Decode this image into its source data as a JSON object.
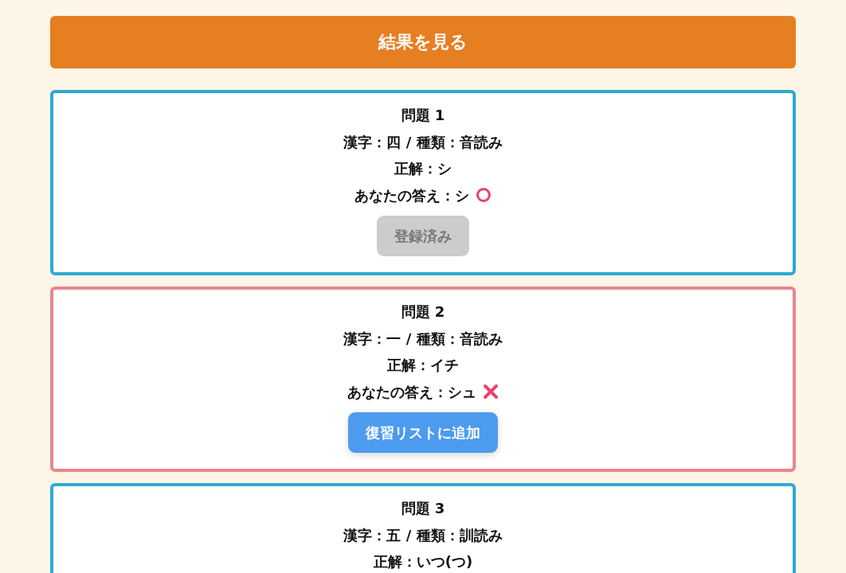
{
  "results_button": {
    "label": "結果を見る"
  },
  "questions": [
    {
      "title": "問題 1",
      "kanji_line": "漢字：四 / 種類：音読み",
      "correct_line": "正解：シ",
      "your_answer_line": "あなたの答え：シ",
      "correct": true,
      "button": {
        "label": "登録済み",
        "disabled": true
      }
    },
    {
      "title": "問題 2",
      "kanji_line": "漢字：一 / 種類：音読み",
      "correct_line": "正解：イチ",
      "your_answer_line": "あなたの答え：シュ",
      "correct": false,
      "button": {
        "label": "復習リストに追加",
        "disabled": false
      }
    },
    {
      "title": "問題 3",
      "kanji_line": "漢字：五 / 種類：訓読み",
      "correct_line": "正解：いつ(つ)",
      "correct": true
    }
  ]
}
